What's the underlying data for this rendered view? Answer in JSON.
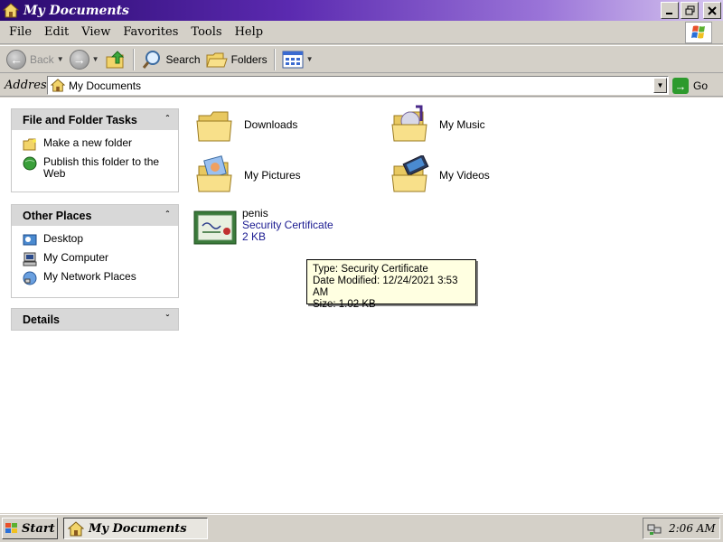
{
  "window": {
    "title": "My Documents"
  },
  "menu": {
    "items": [
      "File",
      "Edit",
      "View",
      "Favorites",
      "Tools",
      "Help"
    ]
  },
  "toolbar": {
    "back": "Back",
    "search": "Search",
    "folders": "Folders"
  },
  "address": {
    "label": "Address",
    "value": "My Documents",
    "go": "Go"
  },
  "sidebar": {
    "file_tasks": {
      "title": "File and Folder Tasks",
      "items": [
        "Make a new folder",
        "Publish this folder to the Web"
      ]
    },
    "other_places": {
      "title": "Other Places",
      "items": [
        "Desktop",
        "My Computer",
        "My Network Places"
      ]
    },
    "details": {
      "title": "Details"
    }
  },
  "files": {
    "folders": [
      "Downloads",
      "My Music",
      "My Pictures",
      "My Videos"
    ],
    "cert": {
      "name": "penis",
      "type": "Security Certificate",
      "size": "2 KB"
    }
  },
  "tooltip": {
    "line1": "Type: Security Certificate",
    "line2": "Date Modified: 12/24/2021 3:53 AM",
    "line3": "Size: 1.02 KB"
  },
  "taskbar": {
    "start": "Start",
    "window": "My Documents",
    "clock": "2:06 AM"
  },
  "colors": {
    "face": "#d4d0c8",
    "title_start": "#2a0a6e",
    "title_end": "#d8c8f0",
    "tooltip": "#ffffe1",
    "folder": "#f2d46a"
  }
}
